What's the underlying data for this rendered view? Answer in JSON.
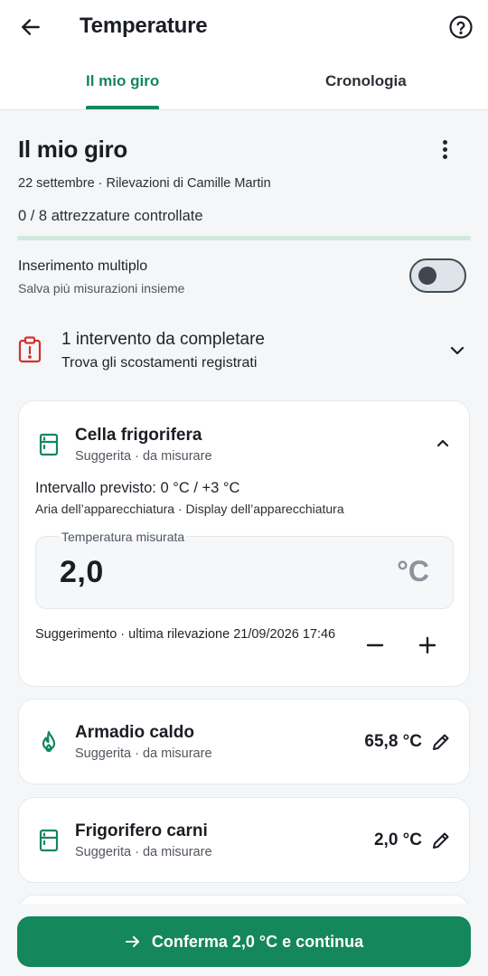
{
  "appbar": {
    "title": "Temperature",
    "back_icon": "arrow-left-icon",
    "help_icon": "help-circle-icon"
  },
  "tabs": [
    {
      "label": "Il mio giro",
      "active": true
    },
    {
      "label": "Cronologia",
      "active": false
    }
  ],
  "round": {
    "title": "Il mio giro",
    "subline": "22 settembre · Rilevazioni di Camille Martin",
    "progress_text": "0 / 8 attrezzature controllate",
    "progress_fraction": 0.0
  },
  "multi_entry": {
    "title": "Inserimento multiplo",
    "subtitle": "Salva più misurazioni insieme",
    "enabled": false
  },
  "alert": {
    "title": "1 intervento da completare",
    "subtitle": "Trova gli scostamenti registrati",
    "color": "#d32f2f"
  },
  "equipment": [
    {
      "name": "Cella frigorifera",
      "status": "Suggerita · da misurare",
      "expanded": true,
      "range": "Intervallo previsto: 0 °C / +3 °C",
      "range_detail": "Aria dell’apparecchiatura · Display dell’apparecchiatura",
      "field_label": "Temperatura misurata",
      "value": "2,0",
      "unit": "°C",
      "hint": "Suggerimento · ultima rilevazione 21/09/2026 17:46"
    },
    {
      "name": "Armadio caldo",
      "status": "Suggerita · da misurare",
      "value": "65,8 °C",
      "icon": "flame-icon"
    },
    {
      "name": "Frigorifero carni",
      "status": "Suggerita · da misurare",
      "value": "2,0 °C",
      "icon": "fridge-icon"
    }
  ],
  "cta": {
    "label": "Conferma 2,0 °C e continua"
  },
  "colors": {
    "accent": "#14875c",
    "alert": "#d32f2f"
  }
}
